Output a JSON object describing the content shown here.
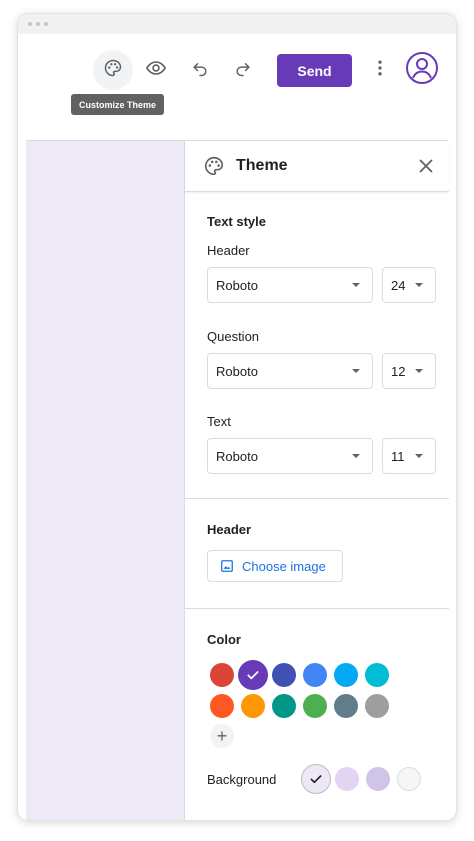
{
  "toolbar": {
    "tooltip": "Customize Theme",
    "send_label": "Send",
    "icons": [
      "palette-icon",
      "eye-icon",
      "undo-icon",
      "redo-icon",
      "more-vert-icon",
      "account-icon"
    ]
  },
  "theme_panel": {
    "title": "Theme",
    "text_style": {
      "title": "Text style",
      "header": {
        "label": "Header",
        "font": "Roboto",
        "size": "24"
      },
      "question": {
        "label": "Question",
        "font": "Roboto",
        "size": "12"
      },
      "text": {
        "label": "Text",
        "font": "Roboto",
        "size": "11"
      }
    },
    "header_section": {
      "title": "Header",
      "choose_image_label": "Choose image"
    },
    "color_section": {
      "title": "Color",
      "theme_colors": [
        "#db4437",
        "#673ab7",
        "#3f51b5",
        "#4285f4",
        "#03a9f4",
        "#00bcd4",
        "#ff5722",
        "#ff9800",
        "#009688",
        "#4caf50",
        "#607d8b",
        "#9e9e9e"
      ],
      "selected_color": "#673ab7",
      "add_symbol": "+",
      "background_label": "Background",
      "background_colors": [
        "#ede7f6",
        "#e1d5f3",
        "#d1c4e9",
        "#f6f6f6"
      ],
      "selected_background": "#ede7f6"
    }
  },
  "colors": {
    "accent": "#673ab7",
    "link": "#1a73e8",
    "canvas": "#ede9f7"
  }
}
